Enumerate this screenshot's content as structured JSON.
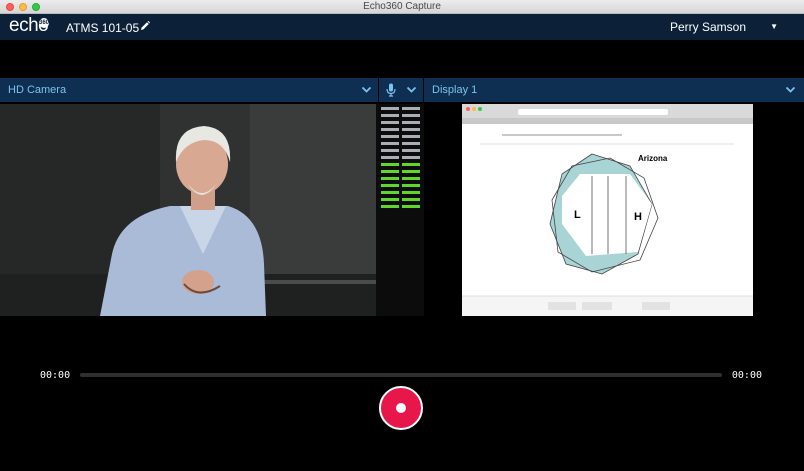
{
  "window": {
    "title": "Echo360 Capture"
  },
  "app": {
    "logo": "echo",
    "logo_sup": "360",
    "course_title": "ATMS 101-05",
    "user_name": "Perry Samson",
    "user_caret": "▼"
  },
  "sources": {
    "camera_label": "HD Camera",
    "display_label": "Display 1"
  },
  "icons": {
    "pencil": "pencil-icon",
    "mic": "microphone-icon",
    "chevron": "chevron-down-icon",
    "record": "record-icon"
  },
  "audio_meter": {
    "segments": 30,
    "active_segments": 14,
    "active_color": "#5ed62a",
    "inactive_color": "#a9adb6"
  },
  "slide": {
    "label_arizona": "Arizona",
    "label_low": "L",
    "label_high": "H"
  },
  "playback": {
    "elapsed": "00:00",
    "total": "00:00",
    "progress": 0
  },
  "colors": {
    "appbar": "#0c2038",
    "sourcebar": "#0e2e52",
    "source_text": "#7cc3ef",
    "record": "#e8174b"
  }
}
